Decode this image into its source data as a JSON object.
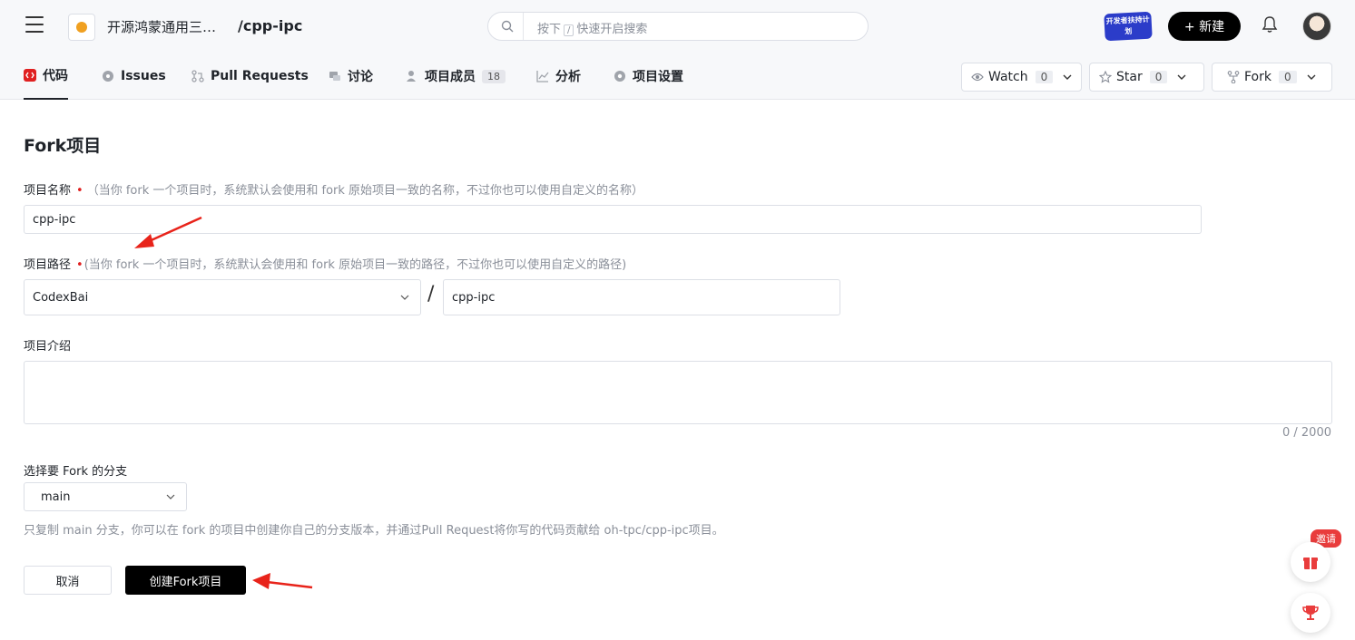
{
  "header": {
    "org_name": "开源鸿蒙通用三…",
    "repo_name": "/cpp-ipc",
    "search_prefix": "按下",
    "search_key": "/",
    "search_suffix": "快速开启搜索",
    "badge_text": "开发者扶持计划",
    "new_button": "+ 新建"
  },
  "tabs": [
    {
      "label": "代码",
      "icon": "code-icon"
    },
    {
      "label": "Issues",
      "icon": "issues-icon"
    },
    {
      "label": "Pull Requests",
      "icon": "pull-request-icon"
    },
    {
      "label": "讨论",
      "icon": "discussion-icon"
    },
    {
      "label": "项目成员",
      "icon": "members-icon",
      "count": "18"
    },
    {
      "label": "分析",
      "icon": "analytics-icon"
    },
    {
      "label": "项目设置",
      "icon": "settings-icon"
    }
  ],
  "actions": {
    "watch": {
      "label": "Watch",
      "count": "0"
    },
    "star": {
      "label": "Star",
      "count": "0"
    },
    "fork": {
      "label": "Fork",
      "count": "0"
    }
  },
  "form": {
    "title": "Fork项目",
    "name_label": "项目名称",
    "name_hint": "（当你 fork 一个项目时，系统默认会使用和 fork 原始项目一致的名称，不过你也可以使用自定义的名称）",
    "name_value": "cpp-ipc",
    "path_label": "项目路径",
    "path_hint": "(当你 fork 一个项目时，系统默认会使用和 fork 原始项目一致的路径，不过你也可以使用自定义的路径)",
    "path_namespace": "CodexBai",
    "path_separator": "/",
    "path_value": "cpp-ipc",
    "desc_label": "项目介绍",
    "desc_value": "",
    "desc_counter": "0 / 2000",
    "branch_label": "选择要 Fork 的分支",
    "branch_value": "main",
    "branch_note": "只复制 main 分支，你可以在 fork 的项目中创建你自己的分支版本，并通过Pull Request将你写的代码贡献给 oh-tpc/cpp-ipc项目。",
    "cancel_button": "取消",
    "submit_button": "创建Fork项目"
  },
  "floating": {
    "invite_label": "邀请"
  },
  "colors": {
    "accent": "#000000",
    "required": "#e02020",
    "annotation_arrow": "#e8231a"
  }
}
